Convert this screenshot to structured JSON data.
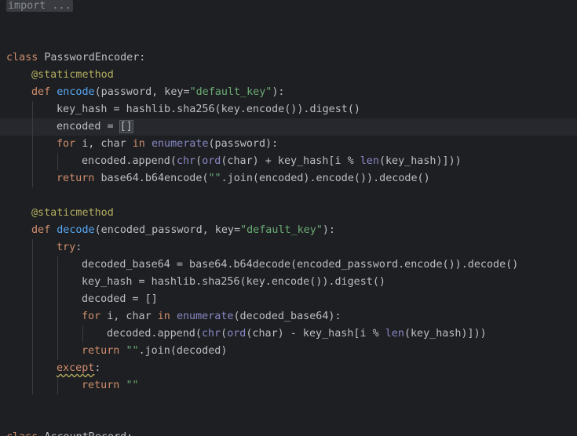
{
  "editor": {
    "lines": [
      {
        "indent": 0,
        "current": false,
        "tokens": [
          {
            "t": "import ...",
            "c": "fold"
          }
        ]
      },
      {
        "indent": 0,
        "current": false,
        "tokens": []
      },
      {
        "indent": 0,
        "current": false,
        "tokens": []
      },
      {
        "indent": 0,
        "current": false,
        "tokens": [
          {
            "t": "class ",
            "c": "kw"
          },
          {
            "t": "PasswordEncoder:",
            "c": ""
          }
        ]
      },
      {
        "indent": 1,
        "current": false,
        "tokens": [
          {
            "t": "@staticmethod",
            "c": "dec"
          }
        ]
      },
      {
        "indent": 1,
        "current": false,
        "tokens": [
          {
            "t": "def ",
            "c": "kw"
          },
          {
            "t": "encode",
            "c": "fn"
          },
          {
            "t": "(password, key=",
            "c": ""
          },
          {
            "t": "\"default_key\"",
            "c": "str"
          },
          {
            "t": "):",
            "c": ""
          }
        ]
      },
      {
        "indent": 2,
        "current": false,
        "tokens": [
          {
            "t": "key_hash = hashlib.sha256(key.encode()).digest()",
            "c": ""
          }
        ]
      },
      {
        "indent": 2,
        "current": true,
        "tokens": [
          {
            "t": "encoded = ",
            "c": ""
          },
          {
            "t": "[]",
            "c": "cursor"
          }
        ]
      },
      {
        "indent": 2,
        "current": false,
        "tokens": [
          {
            "t": "for ",
            "c": "kw"
          },
          {
            "t": "i, char ",
            "c": ""
          },
          {
            "t": "in ",
            "c": "kw"
          },
          {
            "t": "enumerate",
            "c": "bi"
          },
          {
            "t": "(password):",
            "c": ""
          }
        ]
      },
      {
        "indent": 3,
        "current": false,
        "tokens": [
          {
            "t": "encoded.append(",
            "c": ""
          },
          {
            "t": "chr",
            "c": "bi"
          },
          {
            "t": "(",
            "c": ""
          },
          {
            "t": "ord",
            "c": "bi"
          },
          {
            "t": "(char) + key_hash[i % ",
            "c": ""
          },
          {
            "t": "len",
            "c": "bi"
          },
          {
            "t": "(key_hash)]))",
            "c": ""
          }
        ]
      },
      {
        "indent": 2,
        "current": false,
        "tokens": [
          {
            "t": "return ",
            "c": "kw"
          },
          {
            "t": "base64.b64encode(",
            "c": ""
          },
          {
            "t": "\"\"",
            "c": "str"
          },
          {
            "t": ".join(encoded).encode()).decode()",
            "c": ""
          }
        ]
      },
      {
        "indent": 0,
        "current": false,
        "tokens": []
      },
      {
        "indent": 1,
        "current": false,
        "tokens": [
          {
            "t": "@staticmethod",
            "c": "dec"
          }
        ]
      },
      {
        "indent": 1,
        "current": false,
        "tokens": [
          {
            "t": "def ",
            "c": "kw"
          },
          {
            "t": "decode",
            "c": "fn"
          },
          {
            "t": "(encoded_password, key=",
            "c": ""
          },
          {
            "t": "\"default_key\"",
            "c": "str"
          },
          {
            "t": "):",
            "c": ""
          }
        ]
      },
      {
        "indent": 2,
        "current": false,
        "tokens": [
          {
            "t": "try",
            "c": "kw"
          },
          {
            "t": ":",
            "c": ""
          }
        ]
      },
      {
        "indent": 3,
        "current": false,
        "tokens": [
          {
            "t": "decoded_base64 = base64.b64decode(encoded_password.encode()).decode()",
            "c": ""
          }
        ]
      },
      {
        "indent": 3,
        "current": false,
        "tokens": [
          {
            "t": "key_hash = hashlib.sha256(key.encode()).digest()",
            "c": ""
          }
        ]
      },
      {
        "indent": 3,
        "current": false,
        "tokens": [
          {
            "t": "decoded = []",
            "c": ""
          }
        ]
      },
      {
        "indent": 3,
        "current": false,
        "tokens": [
          {
            "t": "for ",
            "c": "kw"
          },
          {
            "t": "i, char ",
            "c": ""
          },
          {
            "t": "in ",
            "c": "kw"
          },
          {
            "t": "enumerate",
            "c": "bi"
          },
          {
            "t": "(decoded_base64):",
            "c": ""
          }
        ]
      },
      {
        "indent": 4,
        "current": false,
        "tokens": [
          {
            "t": "decoded.append(",
            "c": ""
          },
          {
            "t": "chr",
            "c": "bi"
          },
          {
            "t": "(",
            "c": ""
          },
          {
            "t": "ord",
            "c": "bi"
          },
          {
            "t": "(char) - key_hash[i % ",
            "c": ""
          },
          {
            "t": "len",
            "c": "bi"
          },
          {
            "t": "(key_hash)]))",
            "c": ""
          }
        ]
      },
      {
        "indent": 3,
        "current": false,
        "tokens": [
          {
            "t": "return ",
            "c": "kw"
          },
          {
            "t": "\"\"",
            "c": "str"
          },
          {
            "t": ".join(decoded)",
            "c": ""
          }
        ]
      },
      {
        "indent": 2,
        "current": false,
        "tokens": [
          {
            "t": "except",
            "c": "kw squiggle"
          },
          {
            "t": ":",
            "c": ""
          }
        ]
      },
      {
        "indent": 3,
        "current": false,
        "tokens": [
          {
            "t": "return ",
            "c": "kw"
          },
          {
            "t": "\"\"",
            "c": "str"
          }
        ]
      },
      {
        "indent": 0,
        "current": false,
        "tokens": []
      },
      {
        "indent": 0,
        "current": false,
        "tokens": []
      },
      {
        "indent": 0,
        "current": false,
        "tokens": [
          {
            "t": "class ",
            "c": "kw"
          },
          {
            "t": "AccountRecord:",
            "c": ""
          }
        ]
      }
    ]
  },
  "colors": {
    "background": "#1e1f22",
    "current_line": "#26282e",
    "keyword": "#cf8e6d",
    "function": "#56a8f5",
    "decorator": "#b3ae60",
    "string": "#6aab73",
    "builtin": "#8888c6",
    "default": "#bcbec4"
  }
}
